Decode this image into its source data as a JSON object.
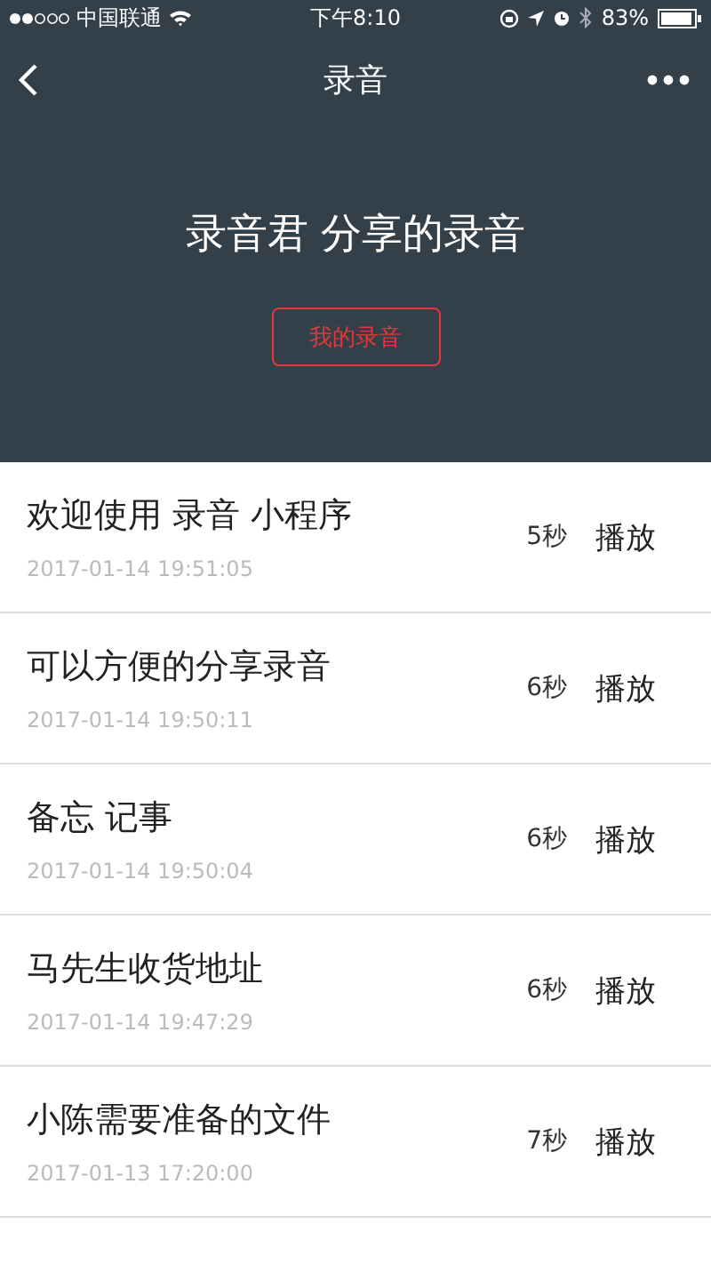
{
  "status_bar": {
    "carrier": "中国联通",
    "time": "下午8:10",
    "battery": "83%"
  },
  "nav_bar": {
    "title": "录音"
  },
  "hero": {
    "title": "录音君 分享的录音",
    "button": "我的录音"
  },
  "recordings": [
    {
      "title": "欢迎使用 录音 小程序",
      "time": "2017-01-14 19:51:05",
      "duration": "5秒",
      "action": "播放"
    },
    {
      "title": "可以方便的分享录音",
      "time": "2017-01-14 19:50:11",
      "duration": "6秒",
      "action": "播放"
    },
    {
      "title": "备忘 记事",
      "time": "2017-01-14 19:50:04",
      "duration": "6秒",
      "action": "播放"
    },
    {
      "title": "马先生收货地址",
      "time": "2017-01-14 19:47:29",
      "duration": "6秒",
      "action": "播放"
    },
    {
      "title": "小陈需要准备的文件",
      "time": "2017-01-13 17:20:00",
      "duration": "7秒",
      "action": "播放"
    }
  ]
}
